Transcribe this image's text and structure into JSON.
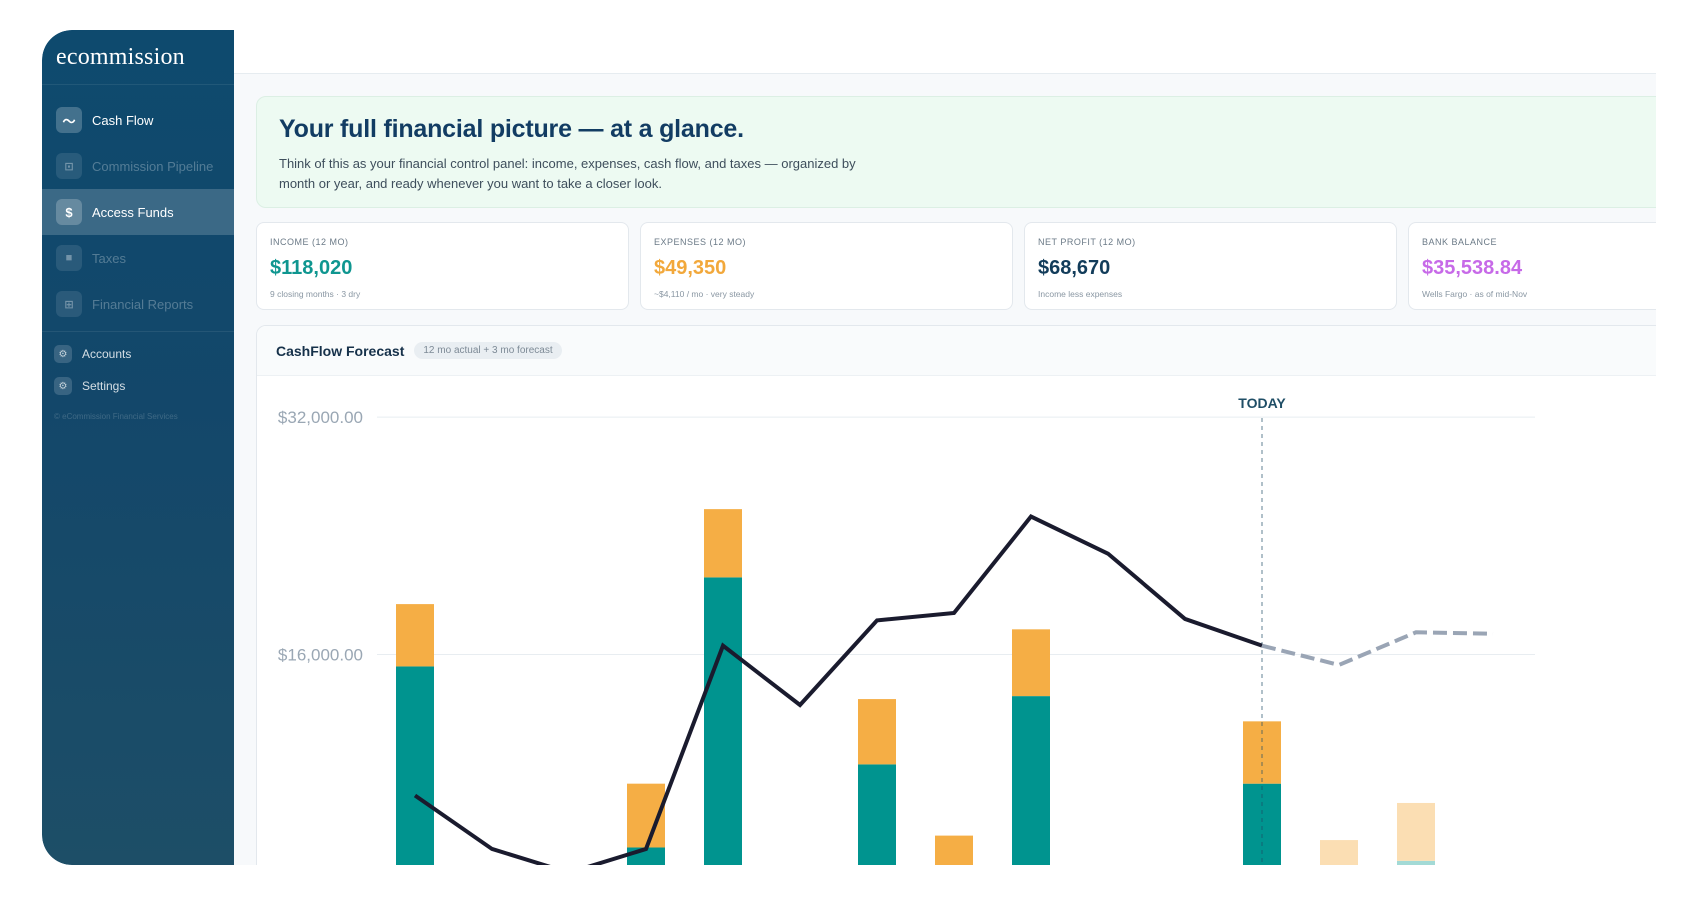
{
  "brand": {
    "name": "ecommission",
    "logo_letter": "e"
  },
  "sidebar": {
    "items": [
      {
        "label": "Cash Flow",
        "icon": "wave-icon",
        "glyph": "〜",
        "state": "normal"
      },
      {
        "label": "Commission Pipeline",
        "icon": "pipeline-icon",
        "glyph": "⊡",
        "state": "dim"
      },
      {
        "label": "Access Funds",
        "icon": "dollar-icon",
        "glyph": "$",
        "state": "active"
      },
      {
        "label": "Taxes",
        "icon": "taxes-icon",
        "glyph": "■",
        "state": "dim"
      },
      {
        "label": "Financial Reports",
        "icon": "reports-icon",
        "glyph": "⊞",
        "state": "dim"
      }
    ],
    "secondary": [
      {
        "label": "Accounts",
        "icon": "gear-icon",
        "glyph": "⚙"
      },
      {
        "label": "Settings",
        "icon": "gear-icon",
        "glyph": "⚙"
      }
    ],
    "copyright": "© eCommission Financial Services"
  },
  "hero": {
    "title": "Your full financial picture — at a glance.",
    "description": "Think of this as your financial control panel: income, expenses, cash flow, and taxes — organized by month or year, and ready whenever you want to take a closer look."
  },
  "kpis": [
    {
      "label": "INCOME (12 MO)",
      "value": "$118,020",
      "sub": "9 closing months · 3 dry",
      "color": "#0f9690"
    },
    {
      "label": "EXPENSES (12 MO)",
      "value": "$49,350",
      "sub": "~$4,110 / mo · very steady",
      "color": "#f2a83b"
    },
    {
      "label": "NET PROFIT (12 MO)",
      "value": "$68,670",
      "sub": "Income less expenses",
      "color": "#123c5a"
    },
    {
      "label": "BANK BALANCE",
      "value": "$35,538.84",
      "sub": "Wells Fargo · as of mid-Nov",
      "color": "#c76ae8"
    }
  ],
  "chart": {
    "title": "CashFlow Forecast",
    "badge": "12 mo actual + 3 mo forecast"
  },
  "chart_data": {
    "type": "bar",
    "yticks": [
      32000,
      16000
    ],
    "ytick_labels": [
      "$32,000.00",
      "$16,000.00"
    ],
    "today_label": "TODAY",
    "today_index": 11,
    "colors": {
      "income": "#00948f",
      "expense": "#f5ae45",
      "income_forecast": "#a3dad6",
      "expense_forecast": "#fbdeb3",
      "line": "#1a1b2e",
      "line_forecast": "#9aa5b5",
      "today": "#1f4e66"
    },
    "series": [
      {
        "name": "Income",
        "values": [
          15200,
          0,
          0,
          3000,
          21200,
          0,
          8600,
          0,
          13200,
          0,
          0,
          7300,
          0,
          2100,
          0
        ]
      },
      {
        "name": "Expenses",
        "values": [
          4200,
          0,
          1300,
          4300,
          4600,
          0,
          4400,
          3800,
          4500,
          0,
          0,
          4200,
          3500,
          3900,
          1700
        ]
      },
      {
        "name": "Net",
        "values": [
          6500,
          2900,
          1300,
          2900,
          16600,
          12600,
          18300,
          18800,
          25300,
          22800,
          18400,
          16600,
          15300,
          17500,
          17400
        ]
      }
    ],
    "forecast_from_index": 12,
    "ylim": [
      0,
      33000
    ]
  }
}
